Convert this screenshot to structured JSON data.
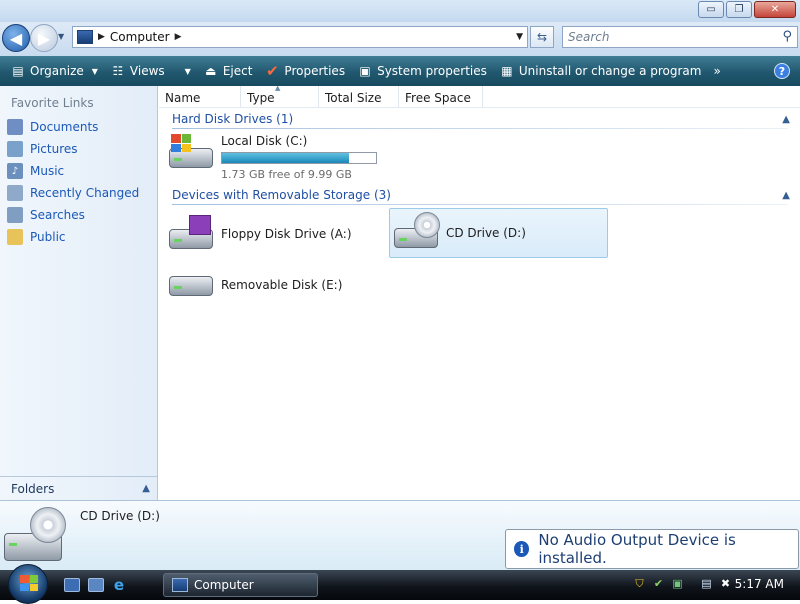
{
  "window": {
    "buttons": {
      "minimize": "▭",
      "restore": "❐",
      "close": "✕"
    }
  },
  "address_bar": {
    "path": "Computer",
    "search_placeholder": "Search"
  },
  "toolbar": {
    "items": [
      {
        "label": "Organize",
        "icon": "organize-icon",
        "has_dropdown": true
      },
      {
        "label": "Views",
        "icon": "views-icon",
        "has_dropdown": true
      },
      {
        "label": "Eject",
        "icon": "eject-icon"
      },
      {
        "label": "Properties",
        "icon": "checkmark-icon"
      },
      {
        "label": "System properties",
        "icon": "system-properties-icon"
      },
      {
        "label": "Uninstall or change a program",
        "icon": "uninstall-icon"
      }
    ],
    "overflow": "»",
    "help": "?"
  },
  "nav_pane": {
    "heading": "Favorite Links",
    "links": [
      {
        "label": "Documents",
        "icon": "documents-icon"
      },
      {
        "label": "Pictures",
        "icon": "pictures-icon"
      },
      {
        "label": "Music",
        "icon": "music-icon"
      },
      {
        "label": "Recently Changed",
        "icon": "recently-changed-icon"
      },
      {
        "label": "Searches",
        "icon": "searches-icon"
      },
      {
        "label": "Public",
        "icon": "folder-icon"
      }
    ],
    "folders_label": "Folders"
  },
  "columns": [
    "Name",
    "Type",
    "Total Size",
    "Free Space"
  ],
  "groups": {
    "hard_disk": "Hard Disk Drives (1)",
    "removable": "Devices with Removable Storage (3)"
  },
  "drives": {
    "c": {
      "name": "Local Disk (C:)",
      "free_text": "1.73 GB free of 9.99 GB",
      "used_fraction": 0.827
    },
    "a": {
      "name": "Floppy Disk Drive (A:)"
    },
    "d": {
      "name": "CD Drive (D:)"
    },
    "e": {
      "name": "Removable Disk (E:)"
    }
  },
  "details_pane": {
    "name": "CD Drive (D:)"
  },
  "notification": {
    "text": "No Audio Output Device is installed."
  },
  "taskbar": {
    "task_label": "Computer",
    "clock": "5:17 AM"
  },
  "colors": {
    "toolbar": "#21586f",
    "link": "#1b58b8",
    "group_header": "#1f4fa3",
    "bar_fill": "#1a88b9"
  }
}
